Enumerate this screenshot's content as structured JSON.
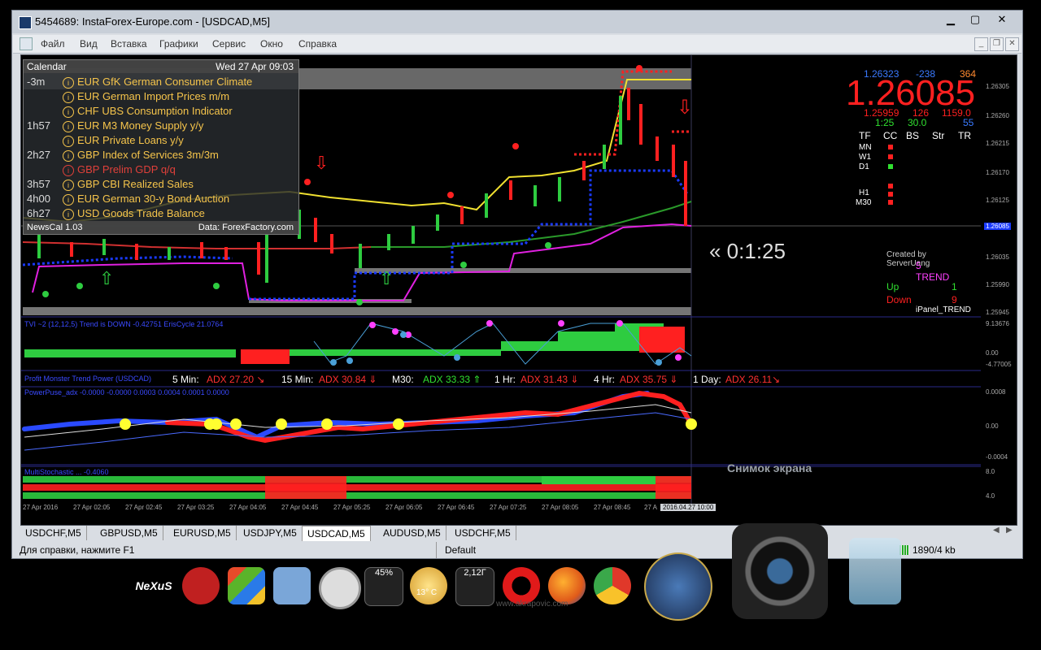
{
  "window": {
    "title": "5454689: InstaForex-Europe.com - [USDCAD,M5]",
    "min": "▁",
    "max": "▢",
    "close": "✕"
  },
  "menu": [
    "Файл",
    "Вид",
    "Вставка",
    "Графики",
    "Сервис",
    "Окно",
    "Справка"
  ],
  "calendar": {
    "title": "Calendar",
    "datetime": "Wed 27 Apr 09:03",
    "rows": [
      {
        "time": "-3m",
        "event": "EUR GfK German Consumer Climate",
        "red": false
      },
      {
        "time": "",
        "event": "EUR German Import Prices m/m",
        "red": false
      },
      {
        "time": "",
        "event": "CHF UBS Consumption Indicator",
        "red": false
      },
      {
        "time": "1h57",
        "event": "EUR M3 Money Supply y/y",
        "red": false
      },
      {
        "time": "",
        "event": "EUR Private Loans y/y",
        "red": false
      },
      {
        "time": "2h27",
        "event": "GBP Index of Services 3m/3m",
        "red": false
      },
      {
        "time": "",
        "event": "GBP Prelim GDP q/q",
        "red": true
      },
      {
        "time": "3h57",
        "event": "GBP CBI Realized Sales",
        "red": false
      },
      {
        "time": "4h00",
        "event": "EUR German 30-y Bond Auction",
        "red": false
      },
      {
        "time": "6h27",
        "event": "USD Goods Trade Balance",
        "red": false
      }
    ],
    "footer_left": "NewsCal 1.03",
    "footer_right": "Data: ForexFactory.com"
  },
  "price_panel": {
    "top_left": "1.26323",
    "top_mid": "-238",
    "top_right": "364",
    "price": "1.26085",
    "low": "1.25959",
    "low_mid": "126",
    "low_right": "1159.0",
    "r2_left": "1:25",
    "r2_mid": "30.0",
    "r2_right": "55",
    "headers": [
      "TF",
      "CC",
      "BS",
      "Str",
      "TR"
    ],
    "tfs": [
      "MN",
      "W1",
      "D1",
      "H1",
      "M30"
    ],
    "created": "Created by ServerUang",
    "trend": "5 TREND",
    "up_label": "Up",
    "up_val": "1",
    "down_label": "Down",
    "down_val": "9",
    "ipanel": "iPanel_TREND"
  },
  "countdown": "« 0:1:25",
  "price_axis": [
    "1.26305",
    "1.26260",
    "1.26215",
    "1.26170",
    "1.26125",
    "1.26085",
    "1.26035",
    "1.25990",
    "1.25945"
  ],
  "indicator1_label": "TVI ~2 (12,12,5) Trend is DOWN -0.42751  ErisCycle 21.0764",
  "indicator1_axis": [
    "9.13676",
    "0.00",
    "-4.77005"
  ],
  "adx_bar": {
    "label": "Profit Monster Trend Power (USDCAD)",
    "items": [
      {
        "tf": "5 Min:",
        "adx": "ADX 27.20 ↘",
        "color": "#ff3030"
      },
      {
        "tf": "15 Min:",
        "adx": "ADX 30.84 ⇓",
        "color": "#ff3030"
      },
      {
        "tf": "M30:",
        "adx": "ADX 33.33 ⇑",
        "color": "#30e030"
      },
      {
        "tf": "1 Hr:",
        "adx": "ADX 31.43 ⇓",
        "color": "#ff3030"
      },
      {
        "tf": "4 Hr:",
        "adx": "ADX 35.75 ⇓",
        "color": "#ff3030"
      },
      {
        "tf": "1 Day:",
        "adx": "ADX 26.11↘",
        "color": "#ff3030"
      }
    ]
  },
  "indicator3_label": "PowerPuse_adx -0.0000 -0.0000 0.0003 0.0004 0.0001 0.0000",
  "indicator3_axis": [
    "0.0008",
    "0.00",
    "-0.0004"
  ],
  "indicator4_label": "MultiStochastic ... -0.4060",
  "indicator4_axis": [
    "8.0",
    "4.0"
  ],
  "screenshot_label": "Снимок экрана",
  "time_axis": [
    "27 Apr 2016",
    "27 Apr 02:05",
    "27 Apr 02:45",
    "27 Apr 03:25",
    "27 Apr 04:05",
    "27 Apr 04:45",
    "27 Apr 05:25",
    "27 Apr 06:05",
    "27 Apr 06:45",
    "27 Apr 07:25",
    "27 Apr 08:05",
    "27 Apr 08:45",
    "27 A"
  ],
  "time_highlight": "2016.04.27 10:00",
  "tabs": [
    "USDCHF,M5",
    "GBPUSD,M5",
    "EURUSD,M5",
    "USDJPY,M5",
    "USDCAD,M5",
    "AUDUSD,M5",
    "USDCHF,M5"
  ],
  "active_tab": 4,
  "status": {
    "help": "Для справки, нажмите F1",
    "profile": "Default",
    "traffic": "1890/4 kb"
  },
  "dock": {
    "cpu": "45%",
    "weather": "13° C",
    "mem": "2,12Г",
    "watermark": "www.akrapovic.com"
  }
}
